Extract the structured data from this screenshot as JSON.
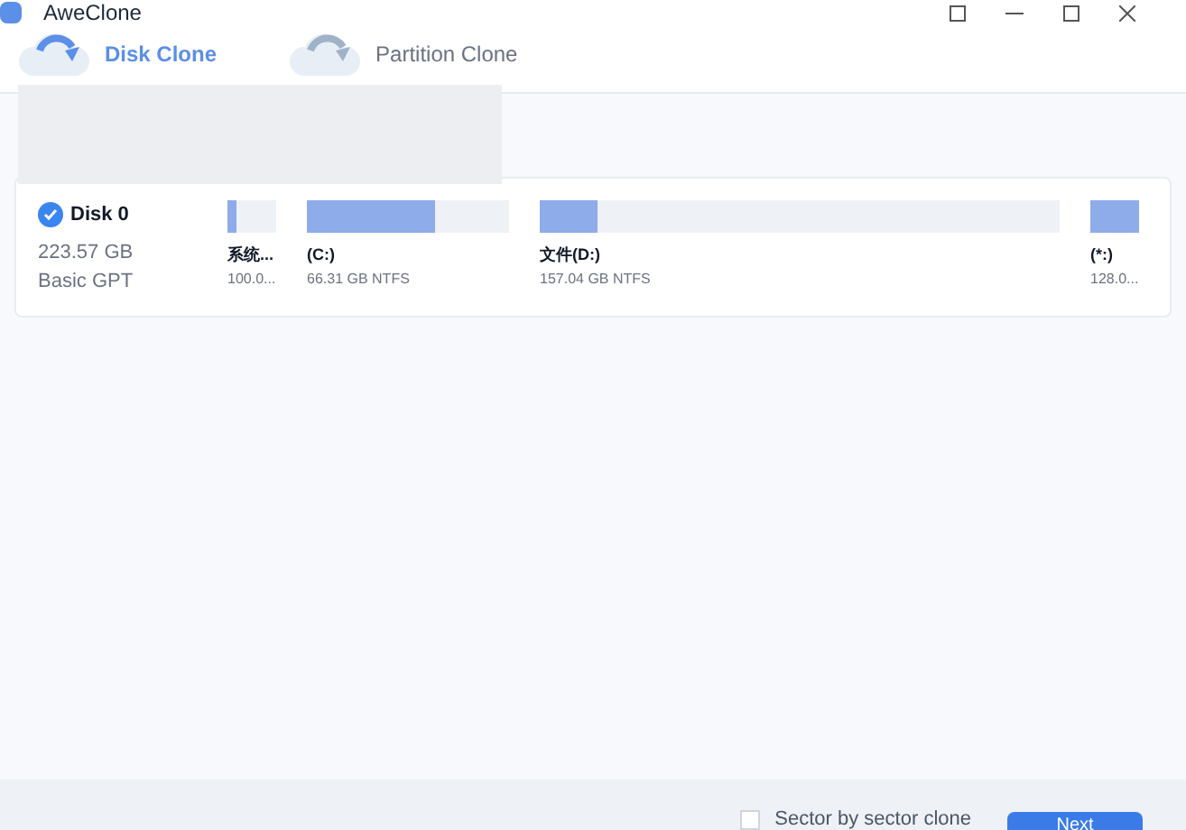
{
  "window": {
    "title": "AweClone"
  },
  "tabs": [
    {
      "label": "Disk Clone",
      "selected": true
    },
    {
      "label": "Partition Clone",
      "selected": false
    }
  ],
  "disk": {
    "name": "Disk 0",
    "checked": true,
    "size": "223.57 GB",
    "type": "Basic GPT",
    "partitions": [
      {
        "name": "系统...",
        "detail": "100.0...",
        "level": 0.2
      },
      {
        "name": "(C:)",
        "detail": "66.31 GB NTFS",
        "level": 0.63
      },
      {
        "name": "文件(D:)",
        "detail": "157.04 GB NTFS",
        "level": 0.11
      },
      {
        "name": "(*:)",
        "detail": "128.0...",
        "level": 1
      }
    ]
  },
  "footer": {
    "option": {
      "label": "Sector by sector clone",
      "checked": false
    },
    "button": "Next"
  }
}
